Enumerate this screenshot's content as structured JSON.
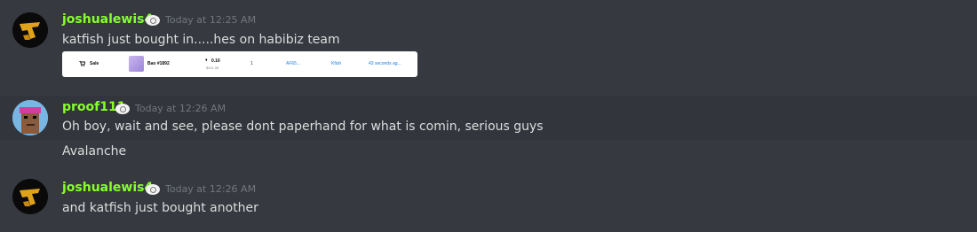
{
  "messages": [
    {
      "username": "joshualewis4",
      "timestamp": "Today at 12:25 AM",
      "text": "katfish just bought in.....hes on habibiz team",
      "embed": {
        "event": "Sale",
        "item": "Bao #1892",
        "price_eth": "0.16",
        "price_usd": "$411.96",
        "quantity": "1",
        "from": "AF65...",
        "to": "Kfish",
        "time": "43 seconds ag..."
      }
    },
    {
      "username": "proof111",
      "timestamp": "Today at 12:26 AM",
      "lines": [
        "Oh boy, wait and see, please dont paperhand for what is comin, serious guys",
        "Avalanche"
      ]
    },
    {
      "username": "joshualewis4",
      "timestamp": "Today at 12:26 AM",
      "text": "and katfish just bought another"
    }
  ],
  "colors": {
    "background": "#36393f",
    "username": "#87ff2a",
    "timestamp": "#72767d",
    "text": "#dcddde",
    "link": "#2081e2"
  }
}
